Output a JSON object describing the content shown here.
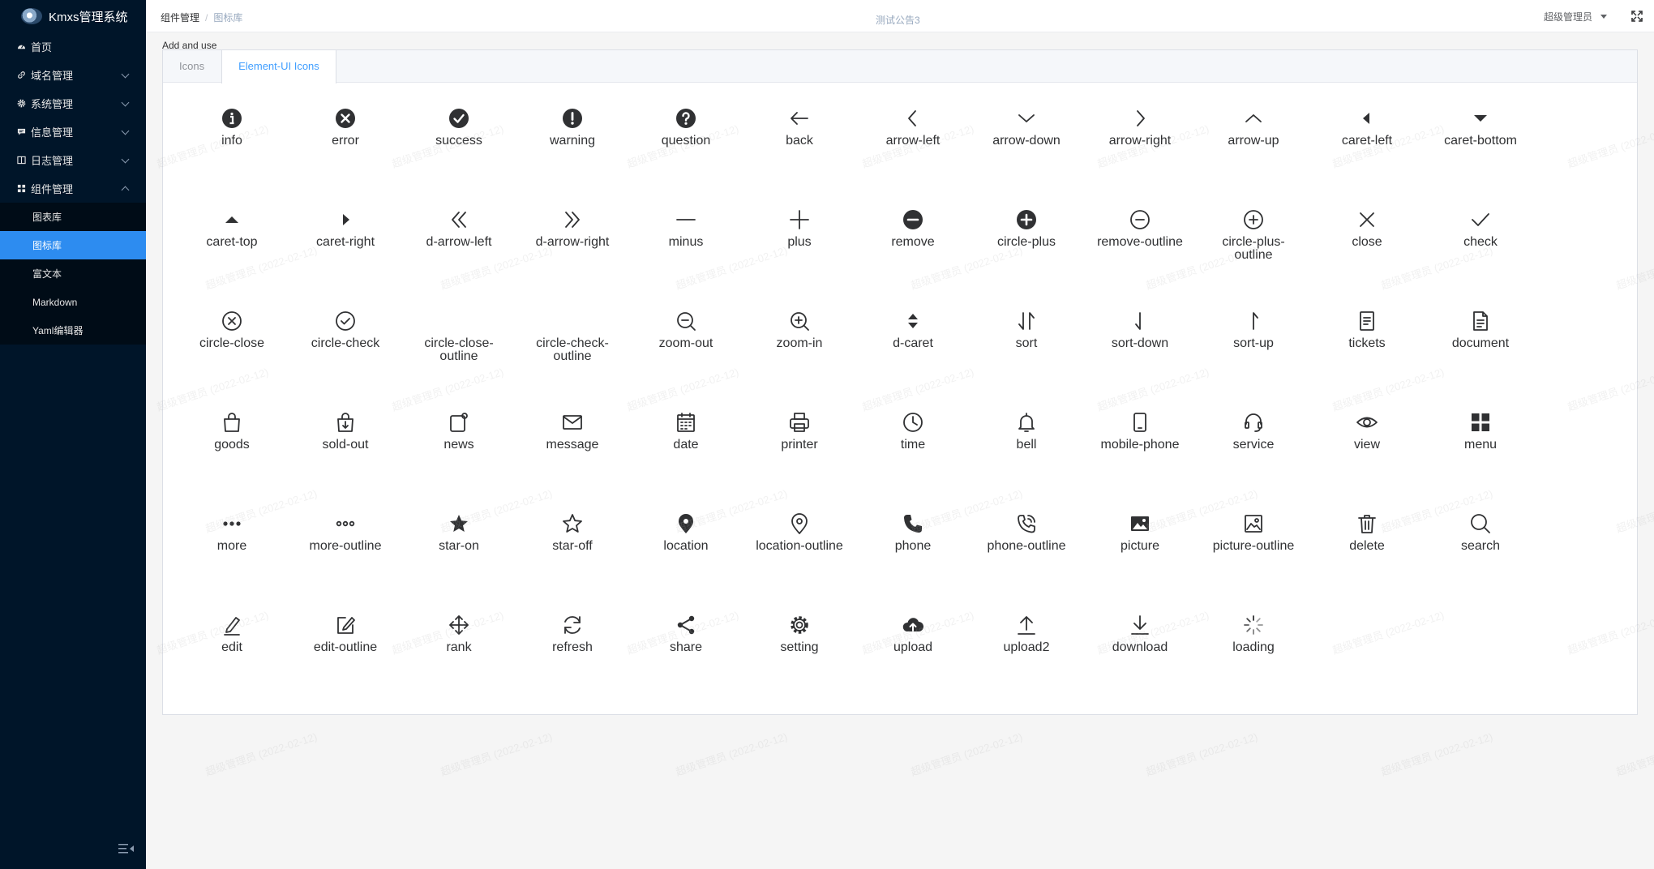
{
  "app": {
    "title": "Kmxs管理系统"
  },
  "sidebar": {
    "items": [
      {
        "label": "首页",
        "icon": "dashboard-icon",
        "expandable": false
      },
      {
        "label": "域名管理",
        "icon": "link-icon",
        "expandable": true
      },
      {
        "label": "系统管理",
        "icon": "gear-icon",
        "expandable": true
      },
      {
        "label": "信息管理",
        "icon": "chat-icon",
        "expandable": true
      },
      {
        "label": "日志管理",
        "icon": "book-icon",
        "expandable": true
      },
      {
        "label": "组件管理",
        "icon": "grid-icon",
        "expandable": true,
        "expanded": true
      }
    ],
    "subitems": [
      {
        "label": "图表库",
        "active": false
      },
      {
        "label": "图标库",
        "active": true
      },
      {
        "label": "富文本",
        "active": false
      },
      {
        "label": "Markdown",
        "active": false
      },
      {
        "label": "Yaml编辑器",
        "active": false
      }
    ]
  },
  "header": {
    "breadcrumb": [
      "组件管理",
      "图标库"
    ],
    "notice": "测试公告3",
    "user": "超级管理员"
  },
  "main": {
    "label": "Add and use",
    "tabs": [
      {
        "label": "Icons",
        "active": false
      },
      {
        "label": "Element-UI Icons",
        "active": true
      }
    ],
    "icons": [
      "info",
      "error",
      "success",
      "warning",
      "question",
      "back",
      "arrow-left",
      "arrow-down",
      "arrow-right",
      "arrow-up",
      "caret-left",
      "caret-bottom",
      "caret-top",
      "caret-right",
      "d-arrow-left",
      "d-arrow-right",
      "minus",
      "plus",
      "remove",
      "circle-plus",
      "remove-outline",
      "circle-plus-outline",
      "close",
      "check",
      "circle-close",
      "circle-check",
      "circle-close-outline",
      "circle-check-outline",
      "zoom-out",
      "zoom-in",
      "d-caret",
      "sort",
      "sort-down",
      "sort-up",
      "tickets",
      "document",
      "goods",
      "sold-out",
      "news",
      "message",
      "date",
      "printer",
      "time",
      "bell",
      "mobile-phone",
      "service",
      "view",
      "menu",
      "more",
      "more-outline",
      "star-on",
      "star-off",
      "location",
      "location-outline",
      "phone",
      "phone-outline",
      "picture",
      "picture-outline",
      "delete",
      "search",
      "edit",
      "edit-outline",
      "rank",
      "refresh",
      "share",
      "setting",
      "upload",
      "upload2",
      "download",
      "loading"
    ]
  },
  "watermark": "超级管理员 (2022-02-12)",
  "colors": {
    "sidebar_bg": "#001529",
    "active": "#2d8cf0",
    "tab_active": "#409eff"
  }
}
